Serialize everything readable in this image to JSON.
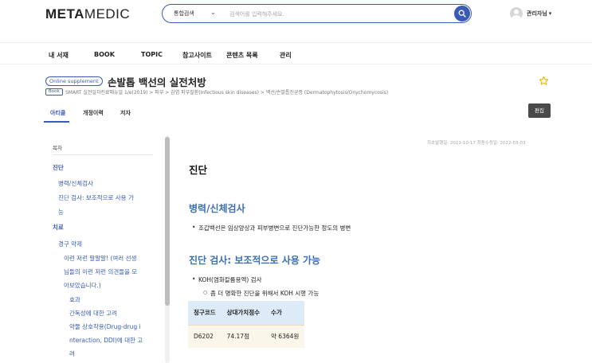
{
  "header": {
    "logo_bold": "META",
    "logo_light": "MEDIC",
    "search": {
      "scope": "통합검색",
      "placeholder": "검색어를 입력해주세요."
    },
    "user": {
      "name": "관리자님",
      "menu_caret": "▾"
    }
  },
  "main_nav": [
    "내 서재",
    "BOOK",
    "TOPIC",
    "참고사이트",
    "콘텐츠 목록",
    "관리"
  ],
  "title_block": {
    "badge": "Online supplement",
    "title": "손발톱 백선의 실전처방",
    "book_badge": "Book",
    "breadcrumb": "SMART 실전일차진료매뉴얼 1/e(2019) > 피부 > 감염 피부질환(Infectious skin diseases) > 백선/손발톱진균증 (Dermatophytosis/Onychomycosis)"
  },
  "sub_tabs": {
    "items": [
      "아티클",
      "개정이력",
      "저자"
    ],
    "active": "아티클"
  },
  "edit_button": "편집",
  "toc": {
    "heading": "목차",
    "items": [
      {
        "label": "진단",
        "level": 1
      },
      {
        "label": "병력/신체검사",
        "level": 2
      },
      {
        "label": "진단 검사: 보조적으로 사용 가",
        "level": 2
      },
      {
        "label": "능",
        "level": 2
      },
      {
        "label": "치료",
        "level": 1
      },
      {
        "label": "경구 약제",
        "level": 2
      },
      {
        "label": "이런 저런 말말말! (여러 선생",
        "level": 3
      },
      {
        "label": "님들의 이런 저런 의견들을 모",
        "level": 3
      },
      {
        "label": "아보았습니다.)",
        "level": 3
      },
      {
        "label": "효과",
        "level": 4
      },
      {
        "label": "간독성에 대한 고려",
        "level": 4
      },
      {
        "label": "약물 상호작용(Drug-drug i",
        "level": 4
      },
      {
        "label": "nteraction, DDI)에 대한 고",
        "level": 4
      },
      {
        "label": "려",
        "level": 4
      }
    ]
  },
  "content": {
    "dates": "최초발행일: 2021-10-17   최종수정일: 2022-03-03",
    "h1": "진단",
    "section1": {
      "title": "병력/신체검사",
      "bullet": "조갑백선은 임상양상과 피부병변으로 진단가능한 정도의 병변"
    },
    "section2": {
      "title": "진단 검사: 보조적으로 사용 가능",
      "bullet": "KOH(염화칼륨용액) 검사",
      "sub_bullet": "좀 더 명확한 진단을 위해서 KOH 시행 가능"
    },
    "fee_table": {
      "headers": [
        "청구코드",
        "상대가치점수",
        "수가"
      ],
      "rows": [
        [
          "D6202",
          "74.17점",
          "약 6364원"
        ]
      ]
    }
  },
  "colors": {
    "accent": "#3a5bb5",
    "heading_blue": "#3a6fb0",
    "star": "#f0b400"
  }
}
